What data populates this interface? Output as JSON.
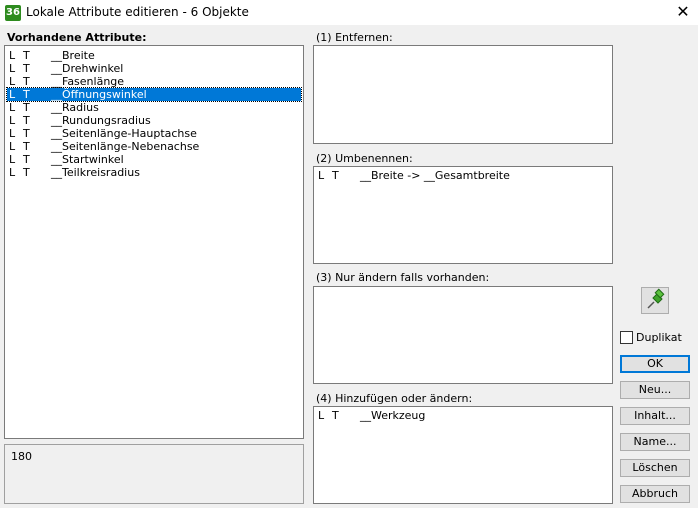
{
  "window": {
    "title": "Lokale Attribute editieren - 6 Objekte",
    "icon_text": "36",
    "icon": "app-icon",
    "close_icon": "close-icon"
  },
  "left": {
    "heading": "Vorhandene Attribute:",
    "rows": [
      {
        "a": "L",
        "b": "T",
        "name": "__Breite",
        "selected": false
      },
      {
        "a": "L",
        "b": "T",
        "name": "__Drehwinkel",
        "selected": false
      },
      {
        "a": "L",
        "b": "T",
        "name": "__Fasenlänge",
        "selected": false
      },
      {
        "a": "L",
        "b": "T",
        "name": "__Öffnungswinkel",
        "selected": true
      },
      {
        "a": "L",
        "b": "T",
        "name": "__Radius",
        "selected": false
      },
      {
        "a": "L",
        "b": "T",
        "name": "__Rundungsradius",
        "selected": false
      },
      {
        "a": "L",
        "b": "T",
        "name": "__Seitenlänge-Hauptachse",
        "selected": false
      },
      {
        "a": "L",
        "b": "T",
        "name": "__Seitenlänge-Nebenachse",
        "selected": false
      },
      {
        "a": "L",
        "b": "T",
        "name": "__Startwinkel",
        "selected": false
      },
      {
        "a": "L",
        "b": "T",
        "name": "__Teilkreisradius",
        "selected": false
      }
    ],
    "value": "180"
  },
  "sections": {
    "remove": {
      "heading": "(1) Entfernen:",
      "rows": []
    },
    "rename": {
      "heading": "(2) Umbenennen:",
      "rows": [
        {
          "a": "L",
          "b": "T",
          "name": "__Breite -> __Gesamtbreite"
        }
      ]
    },
    "change_if_present": {
      "heading": "(3) Nur ändern falls vorhanden:",
      "rows": []
    },
    "add_or_change": {
      "heading": "(4) Hinzufügen oder ändern:",
      "rows": [
        {
          "a": "L",
          "b": "T",
          "name": "__Werkzeug"
        }
      ]
    }
  },
  "buttons": {
    "pin_icon": "pin-icon",
    "duplicate_label": "Duplikat",
    "duplicate_checked": false,
    "ok": "OK",
    "new": "Neu...",
    "content": "Inhalt...",
    "name": "Name...",
    "delete": "Löschen",
    "cancel": "Abbruch"
  },
  "colors": {
    "selection": "#0078d7",
    "icon_green": "#2e8b1f"
  }
}
